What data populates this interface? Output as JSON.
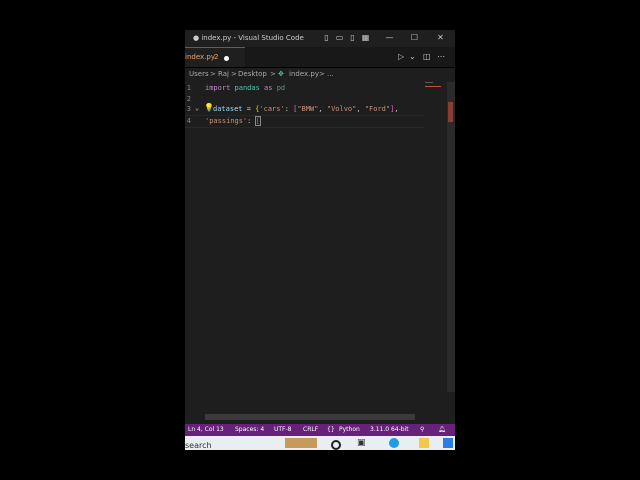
{
  "window": {
    "title": "● index.py - Visual Studio Code"
  },
  "tab": {
    "label": "index.py",
    "problem_count": "2"
  },
  "breadcrumb": {
    "items": [
      "Users",
      ">",
      "Raj",
      ">",
      "Desktop",
      ">",
      "index.py",
      ">",
      "..."
    ]
  },
  "editor": {
    "line_numbers": [
      "1",
      "2",
      "3",
      "4"
    ],
    "lines": {
      "l1_kw1": "import",
      "l1_mod": "pandas",
      "l1_kw2": "as",
      "l1_alias": "pd",
      "l3_var": "dataset",
      "l3_eq": " = ",
      "l3_open": "{",
      "l3_key": "'cars'",
      "l3_colon": ": ",
      "l3_lbr": "[",
      "l3_v1": "\"BMW\"",
      "l3_c1": ", ",
      "l3_v2": "\"Volvo\"",
      "l3_c2": ", ",
      "l3_v3": "\"Ford\"",
      "l3_rbr": "]",
      "l3_end": ",",
      "l4_key": "'passings'",
      "l4_colon": ": ",
      "l4_cursor": "["
    }
  },
  "statusbar": {
    "position": "Ln 4, Col 13",
    "spaces": "Spaces: 4",
    "encoding": "UTF-8",
    "eol": "CRLF",
    "language": "Python",
    "interpreter": "3.11.0 64-bit"
  },
  "taskbar": {
    "search_label": "search"
  },
  "colors": {
    "statusbar": "#68217a",
    "editor_bg": "#1e1e1e",
    "keyword": "#c586c0"
  }
}
